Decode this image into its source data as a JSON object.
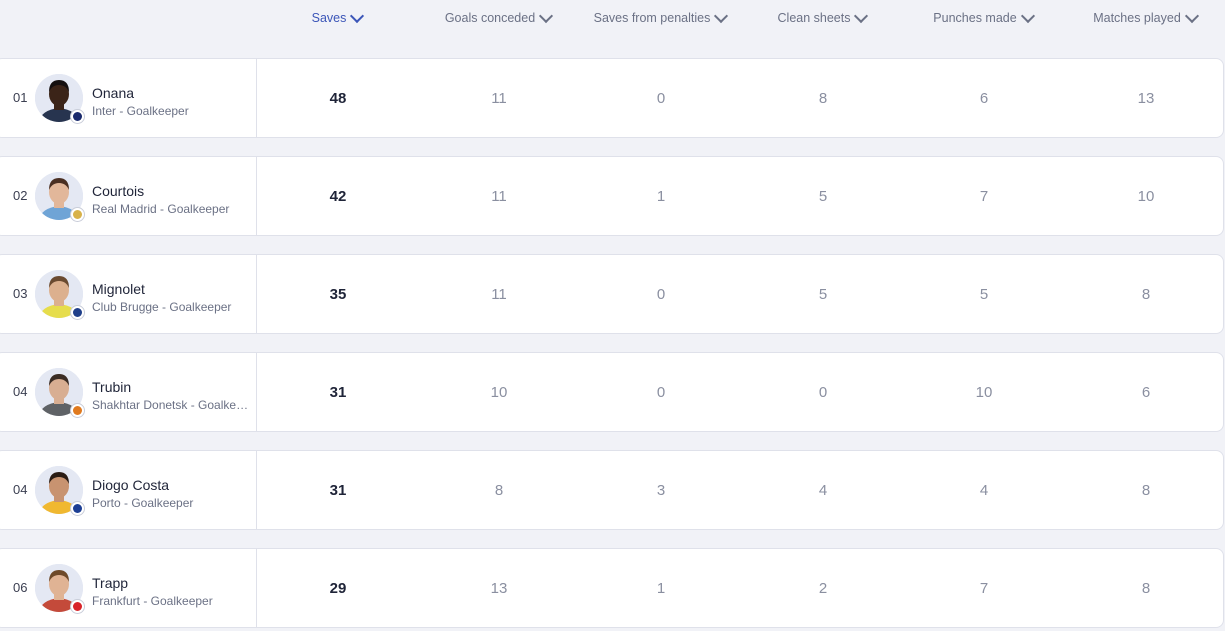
{
  "columns": [
    {
      "label": "Saves",
      "active": true
    },
    {
      "label": "Goals conceded",
      "active": false
    },
    {
      "label": "Saves from penalties",
      "active": false
    },
    {
      "label": "Clean sheets",
      "active": false
    },
    {
      "label": "Punches made",
      "active": false
    },
    {
      "label": "Matches played",
      "active": false
    }
  ],
  "rows": [
    {
      "rank": "01",
      "name": "Onana",
      "team": "Inter - Goalkeeper",
      "stats": [
        "48",
        "11",
        "0",
        "8",
        "6",
        "13"
      ],
      "skin": "#3b2418",
      "hair": "#151010",
      "shirt": "#27344f",
      "badge_color": "#1a2a6c"
    },
    {
      "rank": "02",
      "name": "Courtois",
      "team": "Real Madrid - Goalkeeper",
      "stats": [
        "42",
        "11",
        "1",
        "5",
        "7",
        "10"
      ],
      "skin": "#e2b79a",
      "hair": "#4a2f22",
      "shirt": "#6fa4d6",
      "badge_color": "#d8b24a"
    },
    {
      "rank": "03",
      "name": "Mignolet",
      "team": "Club Brugge - Goalkeeper",
      "stats": [
        "35",
        "11",
        "0",
        "5",
        "5",
        "8"
      ],
      "skin": "#dcb08e",
      "hair": "#6a4a30",
      "shirt": "#e6dd4c",
      "badge_color": "#1f3f8a"
    },
    {
      "rank": "04",
      "name": "Trubin",
      "team": "Shakhtar Donetsk - Goalkeeper",
      "stats": [
        "31",
        "10",
        "0",
        "0",
        "10",
        "6"
      ],
      "skin": "#d8ae92",
      "hair": "#3a2c24",
      "shirt": "#5f6266",
      "badge_color": "#e07a1f"
    },
    {
      "rank": "04",
      "name": "Diogo Costa",
      "team": "Porto - Goalkeeper",
      "stats": [
        "31",
        "8",
        "3",
        "4",
        "4",
        "8"
      ],
      "skin": "#c89370",
      "hair": "#2a1c14",
      "shirt": "#f0b830",
      "badge_color": "#1d3f94"
    },
    {
      "rank": "06",
      "name": "Trapp",
      "team": "Frankfurt - Goalkeeper",
      "stats": [
        "29",
        "13",
        "1",
        "2",
        "7",
        "8"
      ],
      "skin": "#e0b394",
      "hair": "#6e4a2a",
      "shirt": "#c44a3a",
      "badge_color": "#d8242a"
    }
  ]
}
